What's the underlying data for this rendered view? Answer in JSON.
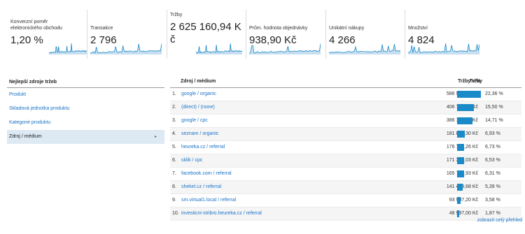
{
  "metrics": [
    {
      "label_line1": "Konverzní poměr",
      "label_line2": "elektronického obchodu",
      "value_line1": "1,20 %",
      "value_line2": ""
    },
    {
      "label_line1": "Transakce",
      "label_line2": "",
      "value_line1": "2 796",
      "value_line2": ""
    },
    {
      "label_line1": "Tržby",
      "label_line2": "",
      "value_line1": "2 625 160,94 K",
      "value_line2": "č"
    },
    {
      "label_line1": "Prům. hodnota objednávky",
      "label_line2": "",
      "value_line1": "938,90 Kč",
      "value_line2": ""
    },
    {
      "label_line1": "Unikátní nákupy",
      "label_line2": "",
      "value_line1": "4 266",
      "value_line2": ""
    },
    {
      "label_line1": "Množství",
      "label_line2": "",
      "value_line1": "4 824",
      "value_line2": ""
    }
  ],
  "left_panel": {
    "title": "Nejlepší zdroje tržeb",
    "items": [
      {
        "label": "Produkt"
      },
      {
        "label": "Skladová jednotka produktu"
      },
      {
        "label": "Kategorie produktu"
      },
      {
        "label": "Zdroj / médium",
        "arrow": "▸"
      }
    ]
  },
  "table": {
    "col_source": "Zdroj / médium",
    "col_revenue": "Tržby",
    "col_percent": "Tržby v %",
    "rows": [
      {
        "num": "1.",
        "source": "google / organic",
        "revenue": "586 917,54 Kč",
        "percent": "22,36 %",
        "share": 22.36
      },
      {
        "num": "2.",
        "source": "(direct) / (none)",
        "revenue": "406 777,57 Kč",
        "percent": "15,50 %",
        "share": 15.5
      },
      {
        "num": "3.",
        "source": "google / cpc",
        "revenue": "386 174,45 Kč",
        "percent": "14,71 %",
        "share": 14.71
      },
      {
        "num": "4.",
        "source": "seznam / organic",
        "revenue": "181 833,30 Kč",
        "percent": "6,93 %",
        "share": 6.93
      },
      {
        "num": "5.",
        "source": "heureka.cz / referral",
        "revenue": "176 768,26 Kč",
        "percent": "6,73 %",
        "share": 6.73
      },
      {
        "num": "6.",
        "source": "sklik / cpc",
        "revenue": "171 357,03 Kč",
        "percent": "6,53 %",
        "share": 6.53
      },
      {
        "num": "7.",
        "source": "facebook.com / referral",
        "revenue": "165 773,93 Kč",
        "percent": "6,31 %",
        "share": 6.31
      },
      {
        "num": "8.",
        "source": "shekel.cz / referral",
        "revenue": "141 453,68 Kč",
        "percent": "5,39 %",
        "share": 5.39
      },
      {
        "num": "9.",
        "source": "sm.virtual1.local / referral",
        "revenue": "93 907,20 Kč",
        "percent": "3,58 %",
        "share": 3.58
      },
      {
        "num": "10.",
        "source": "investicni-stribro.heureka.cz / referral",
        "revenue": "48 997,00 Kč",
        "percent": "1,87 %",
        "share": 1.87
      }
    ]
  },
  "footer_link": "zobrazit celý přehled",
  "colors": {
    "accent": "#1a8ac8",
    "link": "#1a73c8",
    "active_bg": "#dde9f3"
  }
}
